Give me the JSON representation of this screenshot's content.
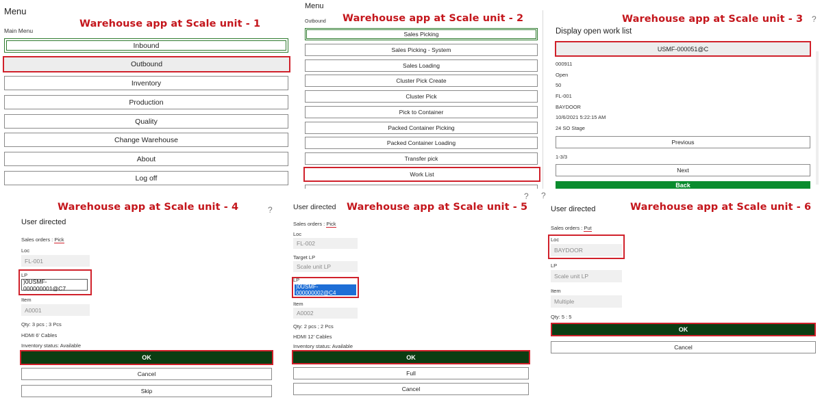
{
  "captions": {
    "p1": "Warehouse app at Scale unit - 1",
    "p2": "Warehouse app at Scale unit - 2",
    "p3": "Warehouse app at Scale unit - 3",
    "p4": "Warehouse app at Scale unit - 4",
    "p5": "Warehouse app at Scale unit - 5",
    "p6": "Warehouse app at Scale unit - 6"
  },
  "help_glyph": "?",
  "p1": {
    "title": "Menu",
    "subtitle": "Main Menu",
    "items": [
      "Inbound",
      "Outbound",
      "Inventory",
      "Production",
      "Quality",
      "Change Warehouse",
      "About",
      "Log off"
    ]
  },
  "p2": {
    "title": "Menu",
    "subtitle": "Outbound",
    "items": [
      "Sales Picking",
      "Sales Picking - System",
      "Sales Loading",
      "Cluster Pick Create",
      "Cluster Pick",
      "Pick to Container",
      "Packed Container Picking",
      "Packed Container Loading",
      "Transfer pick",
      "Work List"
    ]
  },
  "p3": {
    "title": "Display open work list",
    "work_id": "USMF-000051@C",
    "details": [
      "000911",
      "Open",
      "50",
      "FL-001",
      "BAYDOOR",
      "10/6/2021 5:22:15 AM",
      "24 SO Stage"
    ],
    "previous": "Previous",
    "page": "1-3/3",
    "next": "Next",
    "back": "Back"
  },
  "p4": {
    "title": "User directed",
    "mode_prefix": "Sales orders : ",
    "mode": "Pick",
    "loc_label": "Loc",
    "loc_value": "FL-001",
    "lp_label": "LP",
    "lp_value": ")0USMF-000000001@C7",
    "item_label": "Item",
    "item_value": "A0001",
    "qty": "Qty: 3 pcs ; 3 Pcs",
    "desc": "HDMI 6' Cables",
    "status": "Inventory status: Available",
    "ok": "OK",
    "cancel": "Cancel",
    "skip": "Skip"
  },
  "p5": {
    "title": "User directed",
    "mode_prefix": "Sales orders : ",
    "mode": "Pick",
    "loc_label": "Loc",
    "loc_value": "FL-002",
    "target_label": "Target LP",
    "target_value": "Scale unit LP",
    "lp_label": "LP",
    "lp_value": ")0USMF-000000002@C4",
    "item_label": "Item",
    "item_value": "A0002",
    "qty": "Qty: 2 pcs ; 2 Pcs",
    "desc": "HDMI 12' Cables",
    "status": "Inventory status: Available",
    "ok": "OK",
    "full": "Full",
    "cancel": "Cancel"
  },
  "p6": {
    "title": "User directed",
    "mode_prefix": "Sales orders : ",
    "mode": "Put",
    "loc_label": "Loc",
    "loc_value": "BAYDOOR",
    "lp_label": "LP",
    "lp_value": "Scale unit LP",
    "item_label": "Item",
    "item_value": "Multiple",
    "qty": "Qty: 5 : 5",
    "ok": "OK",
    "cancel": "Cancel"
  },
  "colors": {
    "caption_red": "#c4161c",
    "highlight_red": "#d0202a",
    "ok_green": "#0b3d12",
    "back_green": "#0a8c2e"
  }
}
